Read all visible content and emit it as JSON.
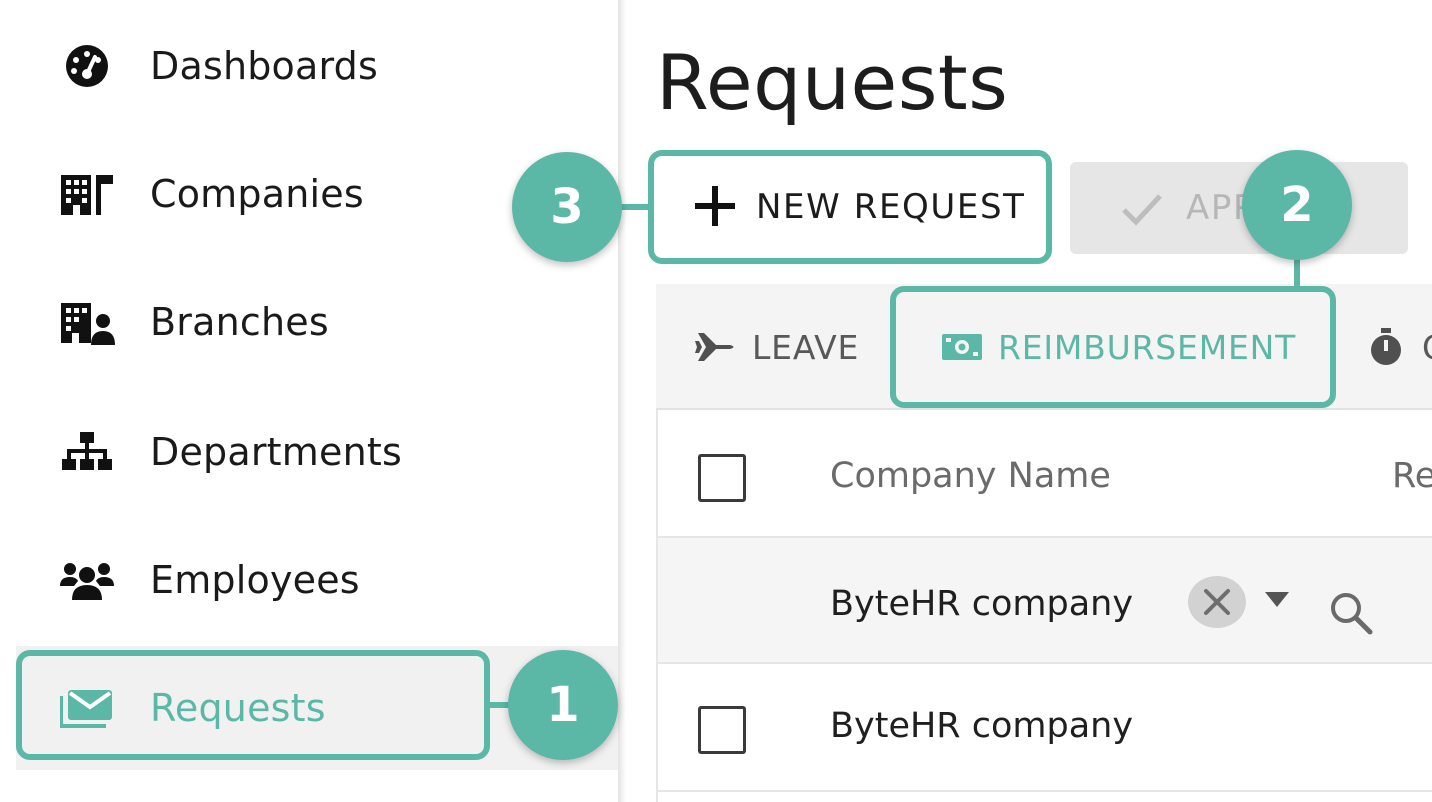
{
  "sidebar": {
    "items": [
      {
        "label": "Dashboards",
        "icon": "dashboard-gauge-icon"
      },
      {
        "label": "Companies",
        "icon": "companies-building-icon"
      },
      {
        "label": "Branches",
        "icon": "branches-building-user-icon"
      },
      {
        "label": "Departments",
        "icon": "departments-sitemap-icon"
      },
      {
        "label": "Employees",
        "icon": "employees-users-icon"
      },
      {
        "label": "Requests",
        "icon": "requests-envelope-icon",
        "active": true
      }
    ]
  },
  "main": {
    "title": "Requests",
    "new_request_label": "NEW REQUEST",
    "approve_label_visible": "APP",
    "tabs": [
      {
        "label": "LEAVE",
        "icon": "plane-icon"
      },
      {
        "label": "REIMBURSEMENT",
        "icon": "money-bill-icon",
        "active": true
      },
      {
        "label": "O",
        "icon": "stopwatch-icon"
      }
    ],
    "table": {
      "headers": [
        "Company Name",
        "Re"
      ],
      "filter_value": "ByteHR company",
      "rows": [
        {
          "company": "ByteHR company"
        }
      ]
    }
  },
  "callouts": {
    "badge_1": "1",
    "badge_2": "2",
    "badge_3": "3"
  },
  "colors": {
    "accent": "#5cb8a6",
    "text": "#1f1f1f",
    "muted": "#6a6a6a",
    "disabled_button": "#e6e6e6"
  }
}
